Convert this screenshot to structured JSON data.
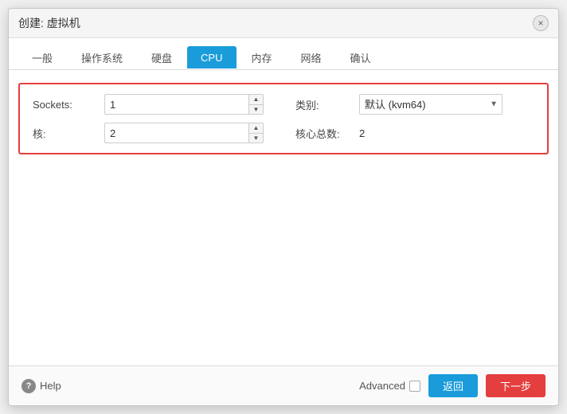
{
  "dialog": {
    "title": "创建: 虚拟机",
    "close_label": "×"
  },
  "tabs": [
    {
      "label": "一般",
      "active": false
    },
    {
      "label": "操作系统",
      "active": false
    },
    {
      "label": "硬盘",
      "active": false
    },
    {
      "label": "CPU",
      "active": true
    },
    {
      "label": "内存",
      "active": false
    },
    {
      "label": "网络",
      "active": false
    },
    {
      "label": "确认",
      "active": false
    }
  ],
  "form": {
    "sockets_label": "Sockets:",
    "sockets_value": "1",
    "cores_label": "核:",
    "cores_value": "2",
    "type_label": "类别:",
    "type_value": "默认 (kvm64)",
    "total_cores_label": "核心总数:",
    "total_cores_value": "2"
  },
  "footer": {
    "help_label": "Help",
    "advanced_label": "Advanced",
    "back_label": "返回",
    "next_label": "下一步"
  }
}
